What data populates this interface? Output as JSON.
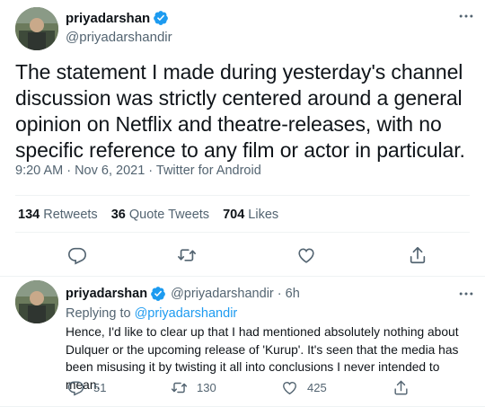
{
  "main_tweet": {
    "display_name": "priyadarshan",
    "handle": "@priyadarshandir",
    "text": "The statement I made during yesterday's channel discussion was strictly centered around a general opinion on Netflix and theatre-releases, with no specific reference to any film or actor in particular.",
    "meta": "9:20 AM · Nov 6, 2021 · Twitter for Android",
    "stats": {
      "retweets": {
        "count": "134",
        "label": "Retweets"
      },
      "quotes": {
        "count": "36",
        "label": "Quote Tweets"
      },
      "likes": {
        "count": "704",
        "label": "Likes"
      }
    }
  },
  "reply_tweet": {
    "display_name": "priyadarshan",
    "handle_time": "@priyadarshandir · 6h",
    "replying_prefix": "Replying to",
    "replying_to": "@priyadarshandir",
    "text": "Hence, I'd like to clear up that I had mentioned absolutely nothing about Dulquer or the upcoming release of 'Kurup'. It's seen that the media has been misusing it by twisting it all into conclusions I never intended to mean.",
    "reply_count": "51",
    "retweet_count": "130",
    "like_count": "425"
  },
  "colors": {
    "text": "#0f1419",
    "secondary": "#536471",
    "accent": "#1d9bf0",
    "divider": "#eff3f4"
  },
  "icons": [
    "verified-badge-icon",
    "more-icon",
    "reply-icon",
    "retweet-icon",
    "like-icon",
    "share-icon"
  ]
}
